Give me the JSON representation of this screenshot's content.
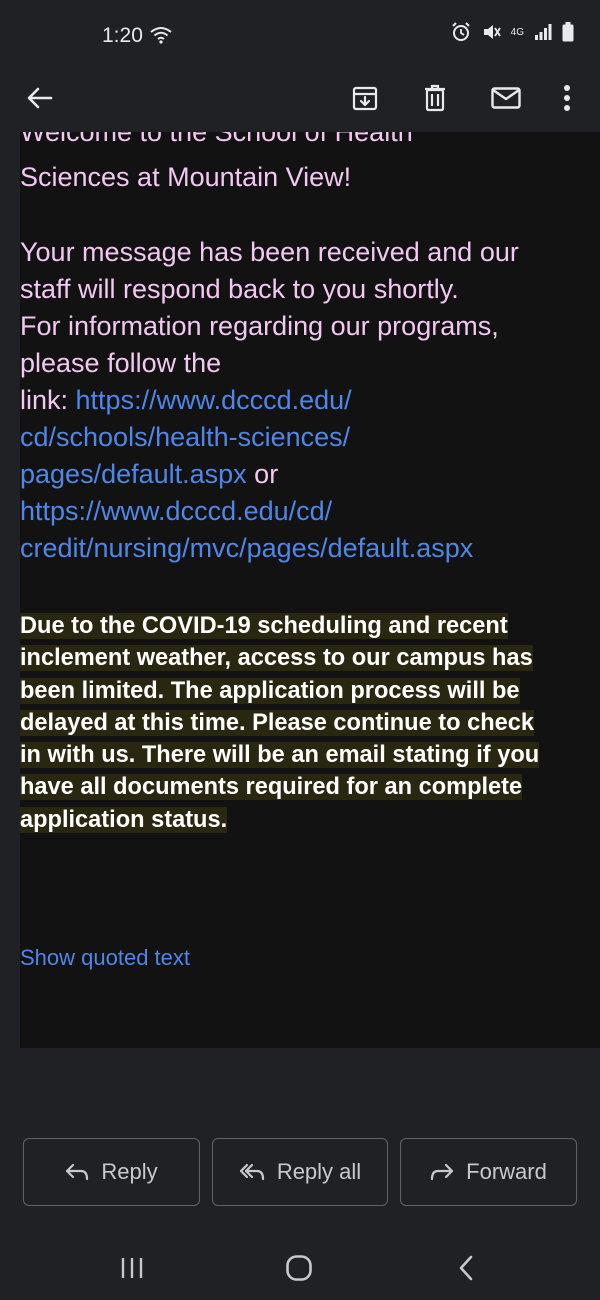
{
  "status_bar": {
    "time": "1:20",
    "network_label": "4G"
  },
  "email": {
    "top_line": "Welcome to the School of Health",
    "line2": "Sciences at Mountain View!",
    "para2_l1": "Your message has been received and our",
    "para2_l2": "staff will respond back to you shortly.",
    "para2_l3": "For information regarding our programs,",
    "para2_l4": "please follow the",
    "link_prefix": "link: ",
    "link1_l1": "https://www.dcccd.edu/",
    "link1_l2": "cd/schools/health-sciences/",
    "link1_l3": "pages/default.aspx",
    "or_text": " or",
    "link2_l1": "https://www.dcccd.edu/cd/",
    "link2_l2": "credit/nursing/mvc/pages/default.aspx",
    "notice_lines": [
      "Due to the COVID-19 scheduling and recent",
      "inclement weather, access to our campus has",
      "been limited. The application process will be",
      "delayed at this time. Please continue to check",
      "in with us. There will be an email stating if you",
      "have all documents required for an complete",
      "application status."
    ],
    "show_quoted": "Show quoted text"
  },
  "actions": {
    "reply": "Reply",
    "reply_all": "Reply all",
    "forward": "Forward"
  },
  "icons": [
    "back-arrow-icon",
    "archive-icon",
    "delete-icon",
    "mark-unread-icon",
    "more-vert-icon",
    "reply-icon",
    "reply-all-icon",
    "forward-icon",
    "recents-icon",
    "home-icon",
    "nav-back-icon",
    "wifi-icon",
    "alarm-icon",
    "mute-icon",
    "signal-icon",
    "battery-icon"
  ]
}
